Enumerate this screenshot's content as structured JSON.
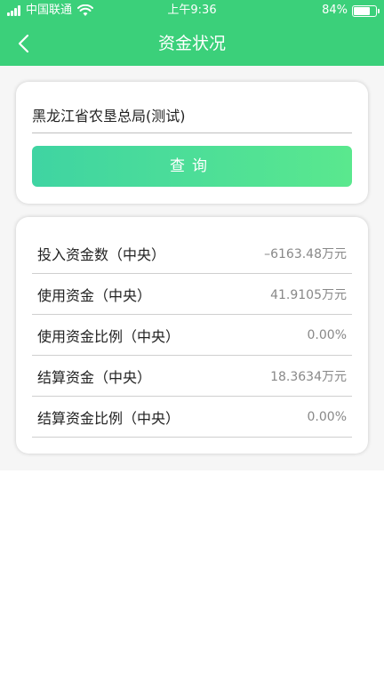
{
  "status_bar": {
    "carrier": "中国联通",
    "time": "上午9:36",
    "battery": "84%",
    "battery_level": 0.84
  },
  "nav": {
    "title": "资金状况",
    "back_icon": "chevron-left-icon"
  },
  "search": {
    "org_name": "黑龙江省农垦总局(测试)",
    "query_label": "查询"
  },
  "funds": {
    "rows": [
      {
        "label": "投入资金数（中央）",
        "value": "–6163.48万元"
      },
      {
        "label": "使用资金（中央）",
        "value": "41.9105万元"
      },
      {
        "label": "使用资金比例（中央）",
        "value": "0.00%"
      },
      {
        "label": "结算资金（中央）",
        "value": "18.3634万元"
      },
      {
        "label": "结算资金比例（中央）",
        "value": "0.00%"
      }
    ]
  },
  "colors": {
    "brand": "#3bd07a",
    "button_start": "#3fd4a2",
    "button_end": "#5ae88e"
  }
}
